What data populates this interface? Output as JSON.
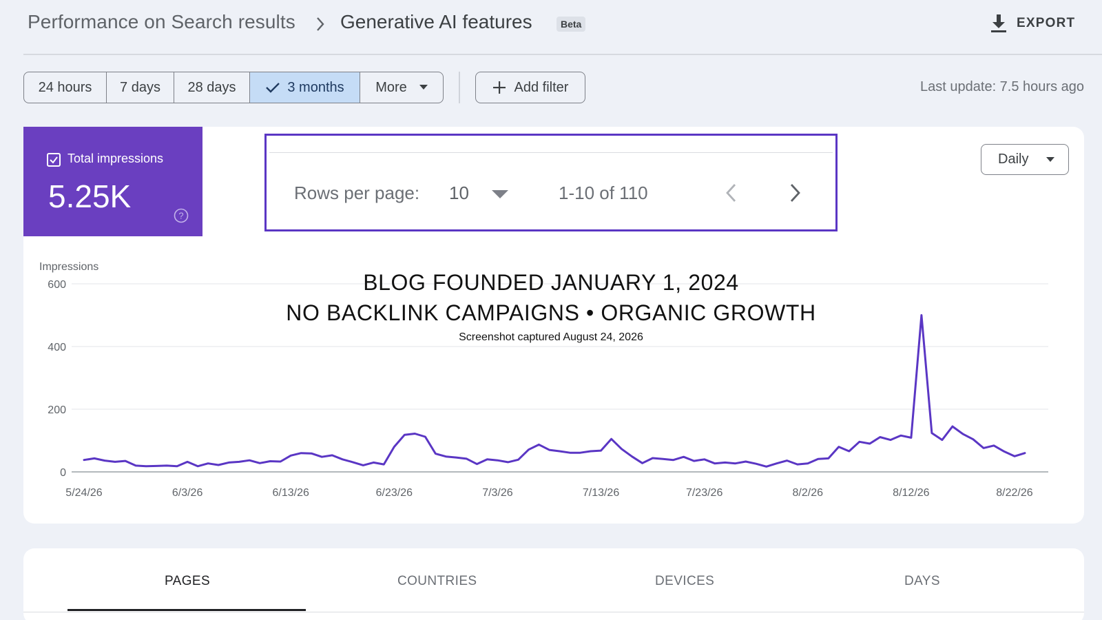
{
  "header": {
    "breadcrumb_parent": "Performance on Search results",
    "breadcrumb_current": "Generative AI features",
    "beta_badge": "Beta",
    "export_label": "EXPORT"
  },
  "toolbar": {
    "ranges": [
      {
        "label": "24 hours",
        "active": false
      },
      {
        "label": "7 days",
        "active": false
      },
      {
        "label": "28 days",
        "active": false
      },
      {
        "label": "3 months",
        "active": true
      },
      {
        "label": "More",
        "active": false
      }
    ],
    "add_filter_label": "Add filter",
    "last_update": "Last update: 7.5 hours ago"
  },
  "metric": {
    "label": "Total impressions",
    "value": "5.25K",
    "checked": true,
    "color": "#6a3fc0"
  },
  "pager": {
    "rows_label": "Rows per page:",
    "rows_value": "10",
    "range": "1-10 of 110"
  },
  "granularity": "Daily",
  "annotations": {
    "line1": "BLOG FOUNDED JANUARY 1, 2024",
    "line2": "NO BACKLINK CAMPAIGNS • ORGANIC GROWTH",
    "line3": "Screenshot captured August 24, 2026"
  },
  "chart_data": {
    "type": "line",
    "ylabel": "Impressions",
    "ylim": [
      0,
      600
    ],
    "yticks": [
      0,
      200,
      400,
      600
    ],
    "grid": true,
    "line_color": "#5a36c4",
    "x_ticks": [
      "5/24/26",
      "6/3/26",
      "6/13/26",
      "6/23/26",
      "7/3/26",
      "7/13/26",
      "7/23/26",
      "8/2/26",
      "8/12/26",
      "8/22/26"
    ],
    "x": [
      "5/24/26",
      "5/25/26",
      "5/26/26",
      "5/27/26",
      "5/28/26",
      "5/29/26",
      "5/30/26",
      "5/31/26",
      "6/1/26",
      "6/2/26",
      "6/3/26",
      "6/4/26",
      "6/5/26",
      "6/6/26",
      "6/7/26",
      "6/8/26",
      "6/9/26",
      "6/10/26",
      "6/11/26",
      "6/12/26",
      "6/13/26",
      "6/14/26",
      "6/15/26",
      "6/16/26",
      "6/17/26",
      "6/18/26",
      "6/19/26",
      "6/20/26",
      "6/21/26",
      "6/22/26",
      "6/23/26",
      "6/24/26",
      "6/25/26",
      "6/26/26",
      "6/27/26",
      "6/28/26",
      "6/29/26",
      "6/30/26",
      "7/1/26",
      "7/2/26",
      "7/3/26",
      "7/4/26",
      "7/5/26",
      "7/6/26",
      "7/7/26",
      "7/8/26",
      "7/9/26",
      "7/10/26",
      "7/11/26",
      "7/12/26",
      "7/13/26",
      "7/14/26",
      "7/15/26",
      "7/16/26",
      "7/17/26",
      "7/18/26",
      "7/19/26",
      "7/20/26",
      "7/21/26",
      "7/22/26",
      "7/23/26",
      "7/24/26",
      "7/25/26",
      "7/26/26",
      "7/27/26",
      "7/28/26",
      "7/29/26",
      "7/30/26",
      "7/31/26",
      "8/1/26",
      "8/2/26",
      "8/3/26",
      "8/4/26",
      "8/5/26",
      "8/6/26",
      "8/7/26",
      "8/8/26",
      "8/9/26",
      "8/10/26",
      "8/11/26",
      "8/12/26",
      "8/13/26",
      "8/14/26",
      "8/15/26",
      "8/16/26",
      "8/17/26",
      "8/18/26",
      "8/19/26",
      "8/20/26",
      "8/21/26",
      "8/22/26",
      "8/23/26"
    ],
    "series": [
      {
        "values": [
          38,
          43,
          36,
          32,
          35,
          20,
          18,
          19,
          20,
          18,
          32,
          18,
          27,
          22,
          30,
          32,
          37,
          28,
          34,
          33,
          52,
          60,
          59,
          48,
          53,
          40,
          31,
          21,
          30,
          24,
          80,
          118,
          122,
          112,
          58,
          49,
          46,
          42,
          25,
          40,
          37,
          31,
          39,
          71,
          87,
          70,
          66,
          61,
          61,
          66,
          68,
          105,
          73,
          49,
          28,
          44,
          41,
          38,
          48,
          35,
          40,
          27,
          30,
          27,
          33,
          26,
          17,
          27,
          36,
          24,
          27,
          41,
          43,
          80,
          66,
          96,
          90,
          111,
          102,
          116,
          109,
          500,
          124,
          102,
          145,
          121,
          104,
          76,
          84,
          65,
          50,
          60
        ]
      }
    ]
  }
}
